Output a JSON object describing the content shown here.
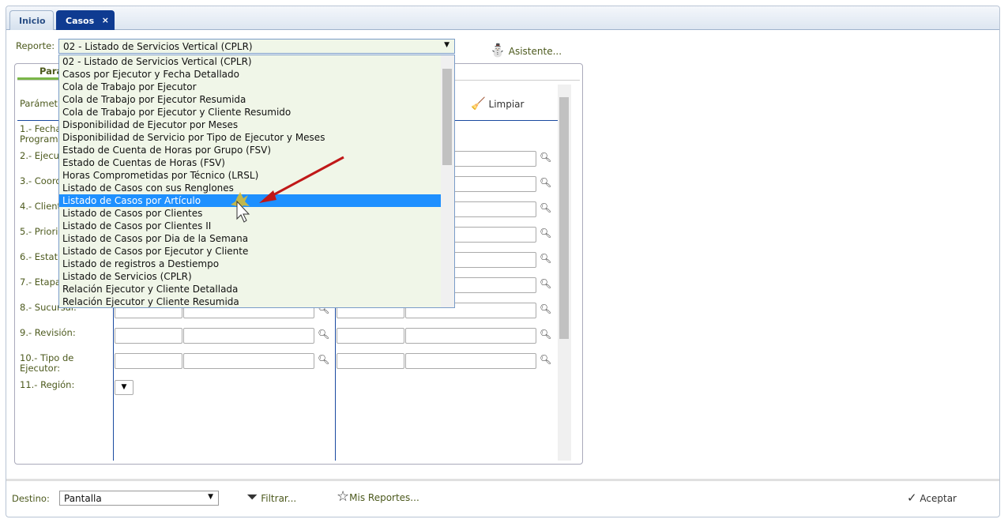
{
  "tabs": [
    {
      "label": "Inicio"
    },
    {
      "label": "Casos",
      "close": "×"
    }
  ],
  "report": {
    "label": "Reporte:",
    "value": "02 - Listado de Servicios Vertical (CPLR)",
    "assistant": "Asistente..."
  },
  "dropdown": {
    "items": [
      "02 - Listado de Servicios Vertical (CPLR)",
      "Casos por Ejecutor y Fecha Detallado",
      "Cola de Trabajo por Ejecutor",
      "Cola de Trabajo por Ejecutor Resumida",
      "Cola de Trabajo por Ejecutor y Cliente Resumido",
      "Disponibilidad de Ejecutor por Meses",
      "Disponibilidad de Servicio por Tipo de Ejecutor y Meses",
      "Estado de Cuenta de Horas por Grupo (FSV)",
      "Estado de Cuentas de Horas (FSV)",
      "Horas Comprometidas por Técnico (LRSL)",
      "Listado de Casos con sus Renglones",
      "Listado de Casos por Artículo",
      "Listado de Casos por Clientes",
      "Listado de Casos por Clientes II",
      "Listado de Casos por Dia de la Semana",
      "Listado de Casos por Ejecutor y Cliente",
      "Listado de registros a Destiempo",
      "Listado de Servicios (CPLR)",
      "Relación Ejecutor y Cliente Detallada",
      "Relación Ejecutor y Cliente Resumida"
    ],
    "highlighted": "Listado de Casos por Artículo"
  },
  "panel": {
    "tab": "Parámetros",
    "header": "Parámetros",
    "clear": "Limpiar",
    "params": [
      {
        "label": "1.- Fecha de Programación:"
      },
      {
        "label": "2.- Ejecutor:"
      },
      {
        "label": "3.- Coordinador:"
      },
      {
        "label": "4.- Cliente:"
      },
      {
        "label": "5.- Prioridad:"
      },
      {
        "label": "6.- Estatus:"
      },
      {
        "label": "7.- Etapa:"
      },
      {
        "label": "8.- Sucursal:"
      },
      {
        "label": "9.- Revisión:"
      },
      {
        "label": "10.- Tipo de Ejecutor:"
      },
      {
        "label": "11.- Región:"
      }
    ]
  },
  "footer": {
    "dest_label": "Destino:",
    "dest_value": "Pantalla",
    "filter": "Filtrar...",
    "my_reports": "Mis Reportes...",
    "accept": "Aceptar"
  },
  "colors": {
    "accent": "#0f3b91",
    "highlight": "#1e90ff",
    "label": "#4d5a1e"
  }
}
